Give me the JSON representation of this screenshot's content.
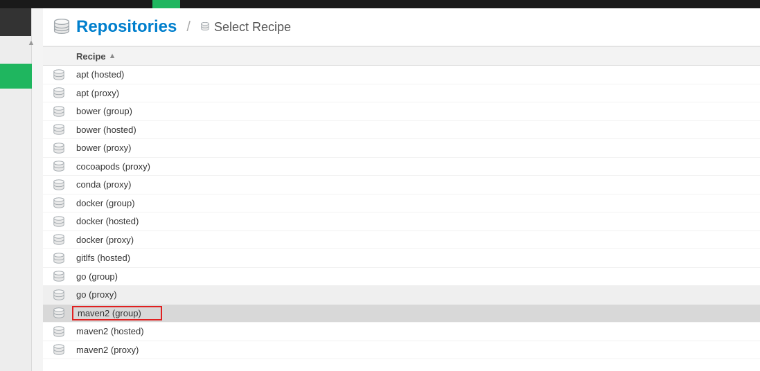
{
  "breadcrumb": {
    "title": "Repositories",
    "subtitle": "Select Recipe"
  },
  "grid": {
    "header": "Recipe",
    "rows": [
      {
        "label": "apt (hosted)"
      },
      {
        "label": "apt (proxy)"
      },
      {
        "label": "bower (group)"
      },
      {
        "label": "bower (hosted)"
      },
      {
        "label": "bower (proxy)"
      },
      {
        "label": "cocoapods (proxy)"
      },
      {
        "label": "conda (proxy)"
      },
      {
        "label": "docker (group)"
      },
      {
        "label": "docker (hosted)"
      },
      {
        "label": "docker (proxy)"
      },
      {
        "label": "gitlfs (hosted)"
      },
      {
        "label": "go (group)"
      },
      {
        "label": "go (proxy)",
        "hovered": true
      },
      {
        "label": "maven2 (group)",
        "highlighted": true,
        "annotated": true
      },
      {
        "label": "maven2 (hosted)"
      },
      {
        "label": "maven2 (proxy)"
      }
    ]
  }
}
